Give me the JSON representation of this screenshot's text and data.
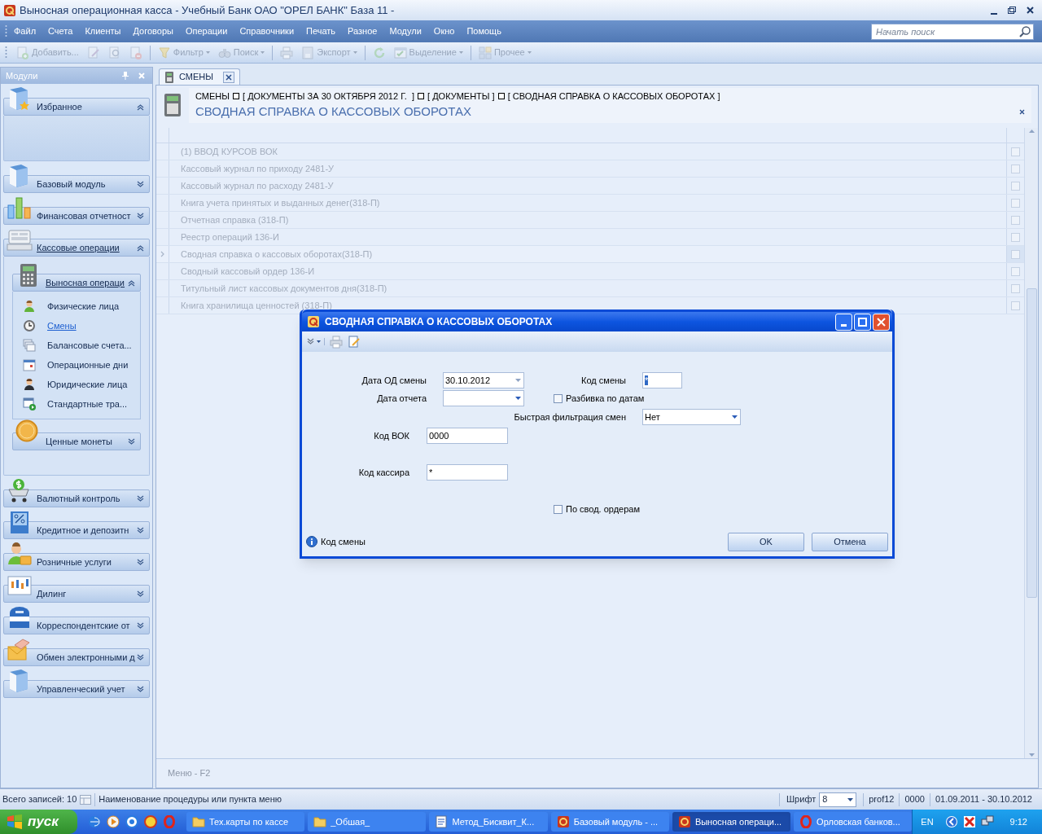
{
  "title_bar": {
    "title": "Выносная операционная касса - Учебный Банк ОАО \"ОРЕЛ БАНК\" База 11 -"
  },
  "menu": [
    "Файл",
    "Счета",
    "Клиенты",
    "Договоры",
    "Операции",
    "Справочники",
    "Печать",
    "Разное",
    "Модули",
    "Окно",
    "Помощь"
  ],
  "search": {
    "placeholder": "Начать поиск"
  },
  "toolbar": [
    {
      "kind": "button",
      "label": "Добавить...",
      "disabled": true
    },
    {
      "kind": "icon",
      "disabled": true
    },
    {
      "kind": "icon",
      "disabled": true
    },
    {
      "kind": "icon",
      "disabled": true
    },
    {
      "kind": "separator"
    },
    {
      "kind": "dropdown",
      "label": "Фильтр",
      "disabled": true
    },
    {
      "kind": "dropdown",
      "label": "Поиск",
      "disabled": true
    },
    {
      "kind": "separator"
    },
    {
      "kind": "icon",
      "disabled": true
    },
    {
      "kind": "dropdown",
      "label": "Экспорт",
      "disabled": true
    },
    {
      "kind": "separator"
    },
    {
      "kind": "icon",
      "disabled": true
    },
    {
      "kind": "dropdown",
      "label": "Выделение",
      "disabled": true
    },
    {
      "kind": "separator"
    },
    {
      "kind": "dropdown",
      "label": "Прочее",
      "disabled": true
    }
  ],
  "modules_panel": {
    "title": "Модули",
    "groups": [
      {
        "label": "Избранное",
        "expanded": true,
        "selected": false
      },
      {
        "label": "Базовый модуль",
        "expanded": false,
        "selected": false
      },
      {
        "label": "Финансовая отчетност",
        "expanded": false,
        "selected": false
      },
      {
        "label": "Кассовые операции",
        "expanded": true,
        "selected": true,
        "subgroups": [
          {
            "label": "Выносная операци",
            "expanded": true,
            "selected": true,
            "items": [
              {
                "label": "Физические лица",
                "selected": false
              },
              {
                "label": "Смены",
                "selected": true
              },
              {
                "label": "Балансовые счета...",
                "selected": false
              },
              {
                "label": "Операционные дни",
                "selected": false
              },
              {
                "label": "Юридические лица",
                "selected": false
              },
              {
                "label": "Стандартные тра...",
                "selected": false
              }
            ]
          },
          {
            "label": "Ценные монеты",
            "expanded": false,
            "selected": false
          }
        ]
      },
      {
        "label": "Валютный контроль",
        "expanded": false,
        "selected": false
      },
      {
        "label": "Кредитное и депозитн",
        "expanded": false,
        "selected": false
      },
      {
        "label": "Розничные услуги",
        "expanded": false,
        "selected": false
      },
      {
        "label": "Дилинг",
        "expanded": false,
        "selected": false
      },
      {
        "label": "Корреспондентские от",
        "expanded": false,
        "selected": false
      },
      {
        "label": "Обмен электронными д",
        "expanded": false,
        "selected": false
      },
      {
        "label": "Управленческий учет",
        "expanded": false,
        "selected": false
      }
    ]
  },
  "tabs": [
    {
      "label": "СМЕНЫ",
      "selected": true
    }
  ],
  "breadcrumb": [
    "СМЕНЫ",
    "[ ДОКУМЕНТЫ ЗА 30 ОКТЯБРЯ 2012 Г.  ]",
    "[ ДОКУМЕНТЫ ]",
    "[ СВОДНАЯ СПРАВКА О КАССОВЫХ ОБОРОТАХ ]"
  ],
  "heading": "СВОДНАЯ СПРАВКА О КАССОВЫХ ОБОРОТАХ",
  "grid_rows": [
    {
      "label": "(1) ВВОД КУРСОВ ВОК",
      "selected": false,
      "checked": false
    },
    {
      "label": "Кассовый журнал по приходу 2481-У",
      "selected": false,
      "checked": false
    },
    {
      "label": "Кассовый журнал по расходу 2481-У",
      "selected": false,
      "checked": false
    },
    {
      "label": "Книга учета принятых и выданных денег(318-П)",
      "selected": false,
      "checked": false
    },
    {
      "label": "Отчетная справка (318-П)",
      "selected": false,
      "checked": false
    },
    {
      "label": "Реестр операций 136-И",
      "selected": false,
      "checked": false
    },
    {
      "label": "Сводная справка о кассовых оборотах(318-П)",
      "selected": true,
      "checked": false
    },
    {
      "label": "Сводный кассовый ордер 136-И",
      "selected": false,
      "checked": false
    },
    {
      "label": "Титульный лист кассовых документов дня(318-П)",
      "selected": false,
      "checked": false
    },
    {
      "label": "Книга хранилища ценностей (318-П)",
      "selected": false,
      "checked": false
    }
  ],
  "grid_hint": "Меню - F2",
  "dialog": {
    "title": "СВОДНАЯ СПРАВКА О КАССОВЫХ ОБОРОТАХ",
    "form_rows": [
      [
        {
          "kind": "date",
          "label": "Дата ОД смены",
          "value": "30.10.2012"
        },
        {
          "kind": "text",
          "label": "Код смены",
          "value": "*",
          "selected": true
        }
      ],
      [
        {
          "kind": "date",
          "label": "Дата отчета"
        },
        {
          "kind": "checkbox",
          "label": "Разбивка по датам",
          "checked": false
        }
      ],
      [
        {
          "kind": "select",
          "label": "Быстрая фильтрация смен",
          "value": "Нет"
        }
      ],
      [
        {
          "kind": "text",
          "label": "Код ВОК",
          "value": "0000",
          "selected": false
        }
      ],
      [
        {
          "kind": "text",
          "label": "Код кассира",
          "value": "*",
          "selected": false
        }
      ],
      [
        {
          "kind": "checkbox",
          "label": "По свод. ордерам",
          "checked": false
        }
      ]
    ],
    "info": "Код смены",
    "buttons": [
      "OK",
      "Отмена"
    ]
  },
  "status_bar": {
    "records": "Всего записей: 10",
    "hint": "Наименование процедуры или пункта меню",
    "font_label": "Шрифт",
    "font_value": "8",
    "user": "prof12",
    "code": "0000",
    "period": "01.09.2011 - 30.10.2012"
  },
  "taskbar": {
    "start": "пуск",
    "tasks": [
      {
        "label": "Тех.карты по кассе",
        "selected": false
      },
      {
        "label": "_Обшая_",
        "selected": false
      },
      {
        "label": "Метод_Бисквит_К...",
        "selected": false
      },
      {
        "label": "Базовый модуль - ...",
        "selected": false
      },
      {
        "label": "Выносная операци...",
        "selected": true
      },
      {
        "label": "Орловская банков...",
        "selected": false
      }
    ],
    "language": "EN",
    "clock": "9:12"
  }
}
